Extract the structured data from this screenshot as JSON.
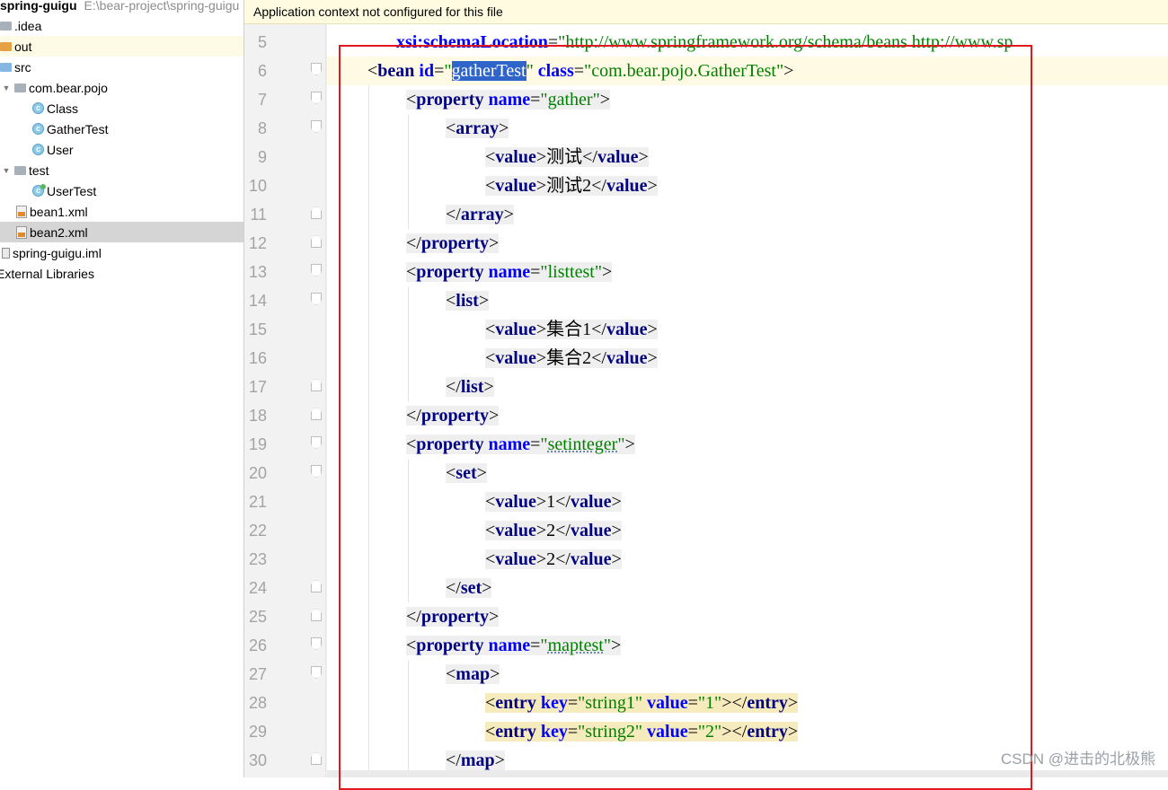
{
  "project": {
    "name": "spring-guigu",
    "path": "E:\\bear-project\\spring-guigu",
    "tree": [
      {
        "label": "spring-guigu",
        "icon": "module-folder-icon",
        "indent": 0
      },
      {
        "label": ".idea",
        "icon": "folder-icon",
        "indent": 1
      },
      {
        "label": "out",
        "icon": "excluded-folder-icon",
        "indent": 1
      },
      {
        "label": "src",
        "icon": "source-folder-icon",
        "indent": 1
      },
      {
        "label": "com.bear.pojo",
        "icon": "package-icon",
        "indent": 2
      },
      {
        "label": "Class",
        "icon": "class-icon",
        "indent": 3
      },
      {
        "label": "GatherTest",
        "icon": "class-icon",
        "indent": 3
      },
      {
        "label": "User",
        "icon": "class-icon",
        "indent": 3
      },
      {
        "label": "test",
        "icon": "package-icon",
        "indent": 2
      },
      {
        "label": "UserTest",
        "icon": "test-class-icon",
        "indent": 3
      },
      {
        "label": "bean1.xml",
        "icon": "spring-xml-icon",
        "indent": 2
      },
      {
        "label": "bean2.xml",
        "icon": "spring-xml-icon",
        "indent": 2
      },
      {
        "label": "spring-guigu.iml",
        "icon": "iml-file-icon",
        "indent": 1
      },
      {
        "label": "External Libraries",
        "icon": "library-icon",
        "indent": 0
      }
    ]
  },
  "editor": {
    "banner": "Application context not configured for this file",
    "line_numbers": [
      "5",
      "6",
      "7",
      "8",
      "9",
      "10",
      "11",
      "12",
      "13",
      "14",
      "15",
      "16",
      "17",
      "18",
      "19",
      "20",
      "21",
      "22",
      "23",
      "24",
      "25",
      "26",
      "27",
      "28",
      "29",
      "30"
    ],
    "current_line": "6",
    "tokens": {
      "xsi_schema": "xsi:schemaLocation",
      "schema_url": "\"http://www.springframework.org/schema/beans http://www.sp",
      "bean": "bean",
      "id": "id",
      "id_value": "gatherTest",
      "class": "class",
      "class_value": "com.bear.pojo.GatherTest",
      "property": "property",
      "name": "name",
      "gather": "gather",
      "array": "array",
      "value": "value",
      "v_test1": "测试",
      "v_test2": "测试2",
      "listtest": "listtest",
      "list": "list",
      "v_set1": "集合1",
      "v_set2": "集合2",
      "setinteger": "setinteger",
      "set": "set",
      "v_one": "1",
      "v_two": "2",
      "maptest": "maptest",
      "map": "map",
      "entry": "entry",
      "key": "key",
      "k1": "string1",
      "k2": "string2",
      "val_attr": "value",
      "ev1": "1",
      "ev2": "2"
    }
  },
  "watermark": "CSDN @进击的北极熊",
  "colors": {
    "tag": "#000080",
    "attr": "#0000ff",
    "string": "#008000",
    "highlight_frame": "#e2181f",
    "selection": "#2f65ca"
  }
}
